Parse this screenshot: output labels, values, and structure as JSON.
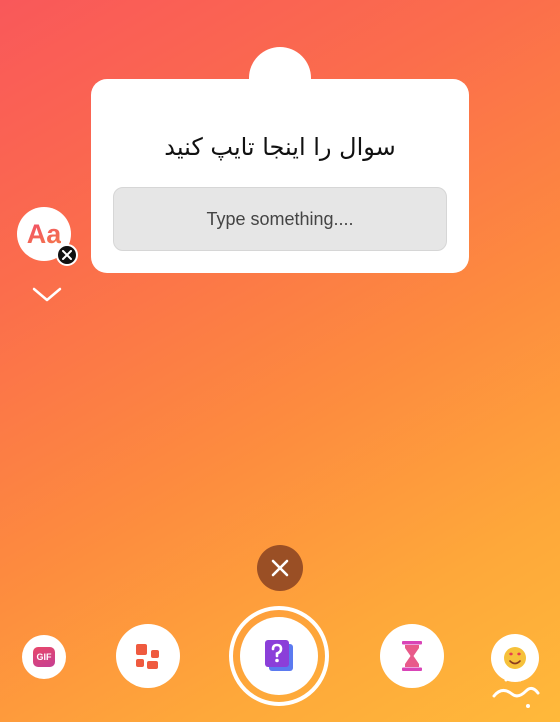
{
  "question_card": {
    "title": "سوال را اینجا تایپ کنید",
    "answer_placeholder": "Type something...."
  },
  "text_style_button": {
    "label": "Aa"
  },
  "sticker_tray": {
    "gif_label": "GIF",
    "items": [
      "gif-sticker",
      "templates",
      "questions",
      "countdown",
      "emoji-slider"
    ]
  },
  "icons": {
    "close": "close-icon",
    "chevron": "chevron-down-icon",
    "templates": "grid-icon",
    "questions": "question-icon",
    "countdown": "hourglass-icon"
  },
  "colors": {
    "accent_question": "#8b3fd9",
    "accent_hourglass": "#d944b7",
    "background_start": "#f9585a",
    "background_end": "#ffb93a"
  }
}
